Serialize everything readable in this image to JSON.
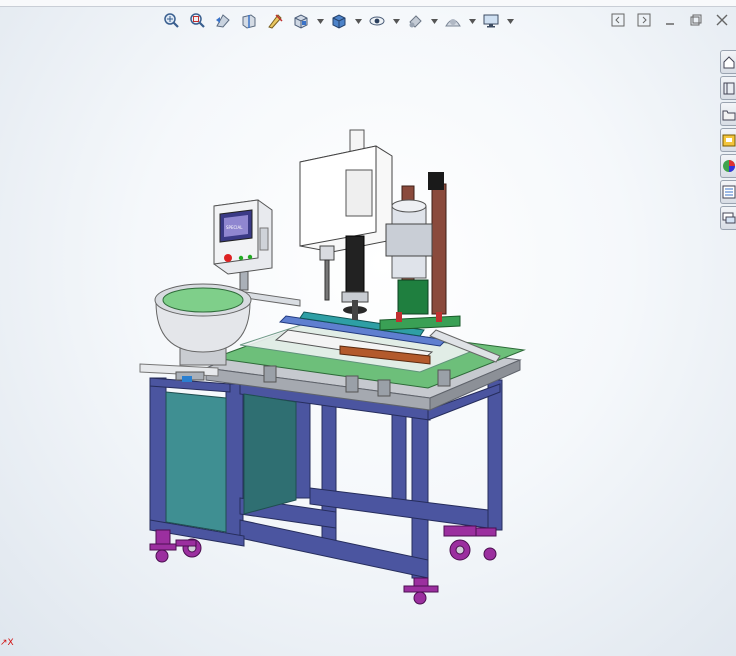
{
  "toolbar": {
    "buttons": [
      {
        "icon": "zoom-to-fit-icon"
      },
      {
        "icon": "zoom-to-area-icon"
      },
      {
        "icon": "previous-view-icon"
      },
      {
        "icon": "section-view-icon"
      },
      {
        "icon": "dynamic-annotation-icon"
      },
      {
        "icon": "view-orientation-icon"
      },
      {
        "icon": "display-style-icon"
      },
      {
        "icon": "hide-show-items-icon"
      },
      {
        "icon": "edit-appearance-icon"
      },
      {
        "icon": "apply-scene-icon"
      },
      {
        "icon": "view-settings-icon"
      }
    ]
  },
  "window_controls": [
    "restore-left-icon",
    "restore-right-icon",
    "minimize-icon",
    "maximize-icon",
    "close-icon"
  ],
  "task_pane": [
    "solidworks-resources-icon",
    "design-library-icon",
    "file-explorer-icon",
    "view-palette-icon",
    "appearances-scenes-icon",
    "custom-properties-icon",
    "forum-icon"
  ],
  "triad_label": "↗X",
  "hmi_screen_text": "SPECIAL",
  "colors": {
    "frame": "#4b55a0",
    "panel_teal": "#3f8f92",
    "plate_green": "#6dbf7a",
    "caster_purple": "#9b2f9f",
    "bowl_green": "#7fcf8a",
    "spindle_white": "#f5f5f5"
  }
}
